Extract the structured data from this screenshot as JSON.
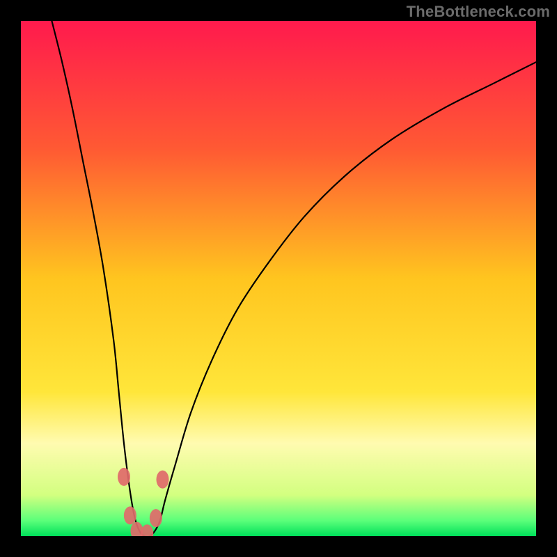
{
  "watermark": "TheBottleneck.com",
  "chart_data": {
    "type": "line",
    "title": "",
    "xlabel": "",
    "ylabel": "",
    "xlim": [
      0,
      100
    ],
    "ylim": [
      0,
      100
    ],
    "grid": false,
    "legend": false,
    "background_gradient": {
      "stops": [
        {
          "pct": 0,
          "color": "#ff1a4d"
        },
        {
          "pct": 25,
          "color": "#ff5a33"
        },
        {
          "pct": 50,
          "color": "#ffc51f"
        },
        {
          "pct": 72,
          "color": "#ffe63a"
        },
        {
          "pct": 82,
          "color": "#fffbb0"
        },
        {
          "pct": 92,
          "color": "#d3ff80"
        },
        {
          "pct": 97,
          "color": "#5bff7a"
        },
        {
          "pct": 100,
          "color": "#00e05a"
        }
      ]
    },
    "series": [
      {
        "name": "bottleneck-curve",
        "x": [
          6,
          8,
          10,
          12,
          14,
          16,
          18,
          19,
          20,
          21,
          22,
          23,
          24,
          25,
          26,
          27,
          28,
          30,
          33,
          37,
          42,
          48,
          55,
          63,
          72,
          82,
          92,
          100
        ],
        "y": [
          100,
          92,
          83,
          73,
          63,
          52,
          38,
          28,
          18,
          10,
          4,
          1,
          0,
          0,
          1,
          3,
          7,
          14,
          24,
          34,
          44,
          53,
          62,
          70,
          77,
          83,
          88,
          92
        ]
      }
    ],
    "markers": [
      {
        "name": "marker-left-upper",
        "x": 20.0,
        "y": 11.5,
        "color": "#e06a6a"
      },
      {
        "name": "marker-right-upper",
        "x": 27.5,
        "y": 11.0,
        "color": "#e06a6a"
      },
      {
        "name": "marker-left-lower",
        "x": 21.2,
        "y": 4.0,
        "color": "#e06a6a"
      },
      {
        "name": "marker-bottom-1",
        "x": 22.5,
        "y": 1.0,
        "color": "#e06a6a"
      },
      {
        "name": "marker-bottom-2",
        "x": 24.5,
        "y": 0.5,
        "color": "#e06a6a"
      },
      {
        "name": "marker-right-lower",
        "x": 26.2,
        "y": 3.5,
        "color": "#e06a6a"
      }
    ]
  }
}
